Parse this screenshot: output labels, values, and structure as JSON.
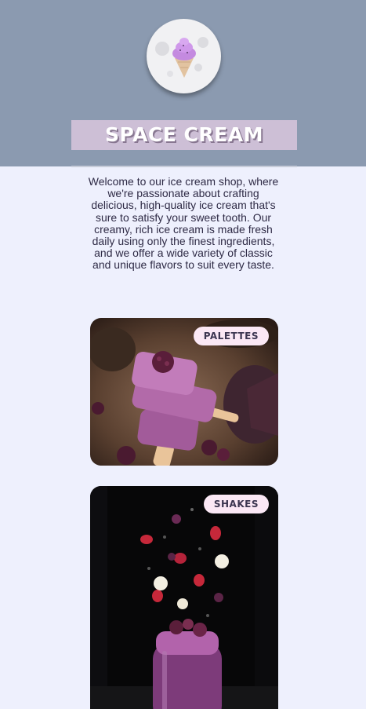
{
  "site": {
    "title": "SPACE CREAM",
    "logo_icon": "ice-cream-cone-icon"
  },
  "intro": {
    "text": "Welcome to our ice cream shop, where we're passionate about crafting delicious, high-quality ice cream that's sure to satisfy your sweet tooth. Our creamy, rich ice cream is made fresh daily using only the finest ingredients, and we offer a wide variety of classic and unique flavors to suit every taste."
  },
  "categories": [
    {
      "label": "PALETTES",
      "image": "ice-pops-with-berries-photo"
    },
    {
      "label": "SHAKES",
      "image": "berry-shake-with-flying-fruit-photo"
    }
  ],
  "colors": {
    "header_bg": "#8b9ab0",
    "page_bg": "#eef0fd",
    "title_band": "#cdbfd6",
    "tag_bg": "#fbe8f5",
    "text": "#2e2a45"
  }
}
